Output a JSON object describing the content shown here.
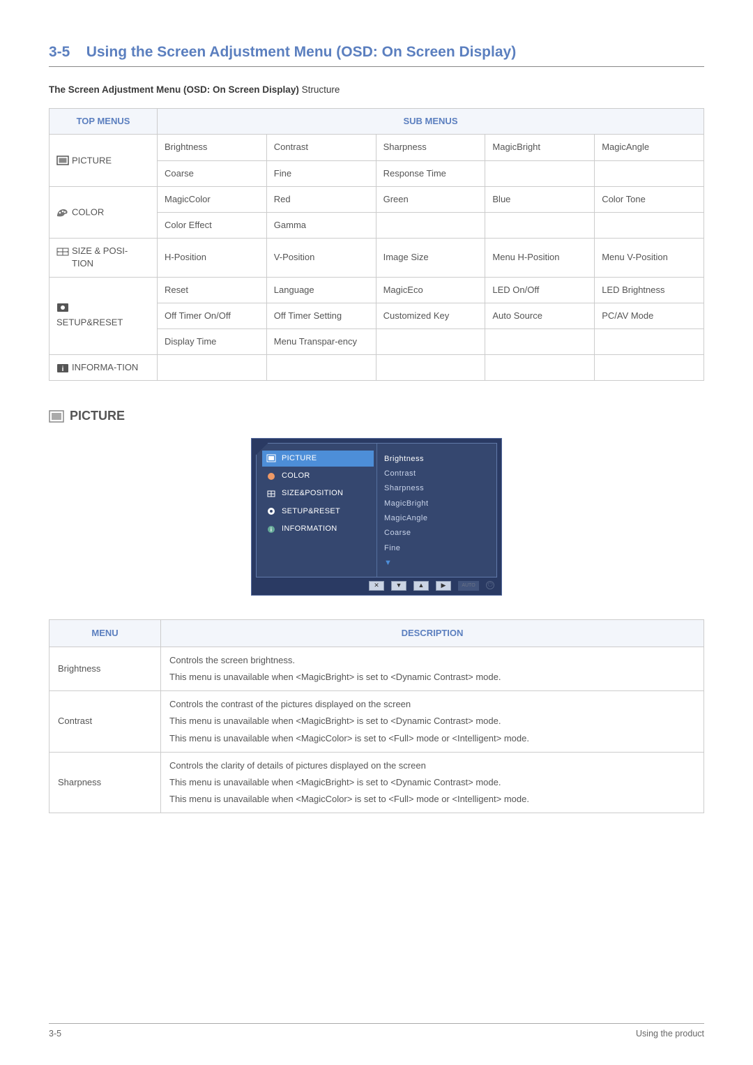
{
  "header": {
    "section_number": "3-5",
    "title": "Using the Screen Adjustment Menu (OSD: On Screen Display)",
    "intro_strong": "The Screen Adjustment Menu (OSD: On Screen Display)",
    "intro_rest": " Structure"
  },
  "struct_table": {
    "top_header": "TOP MENUS",
    "sub_header": "SUB MENUS",
    "rows": [
      {
        "top": "PICTURE",
        "icon": "picture-icon",
        "cells": [
          [
            "Brightness",
            "Contrast",
            "Sharpness",
            "MagicBright",
            "MagicAngle"
          ],
          [
            "Coarse",
            "Fine",
            "Response Time",
            "",
            ""
          ]
        ]
      },
      {
        "top": "COLOR",
        "icon": "color-icon",
        "cells": [
          [
            "MagicColor",
            "Red",
            "Green",
            "Blue",
            "Color Tone"
          ],
          [
            "Color Effect",
            "Gamma",
            "",
            "",
            ""
          ]
        ]
      },
      {
        "top": "SIZE & POSI-TION",
        "icon": "size-icon",
        "cells": [
          [
            "H-Position",
            "V-Position",
            "Image Size",
            "Menu H-Position",
            "Menu V-Position"
          ]
        ]
      },
      {
        "top": "SETUP&RESET",
        "icon": "setup-icon",
        "cells": [
          [
            "Reset",
            "Language",
            "MagicEco",
            "LED On/Off",
            "LED Brightness"
          ],
          [
            "Off Timer On/Off",
            "Off Timer Setting",
            "Customized Key",
            "Auto Source",
            "PC/AV Mode"
          ],
          [
            "Display Time",
            "Menu Transpar-ency",
            "",
            "",
            ""
          ]
        ]
      },
      {
        "top": "INFORMA-TION",
        "icon": "info-icon",
        "cells": [
          [
            "",
            "",
            "",
            "",
            ""
          ]
        ]
      }
    ]
  },
  "section_heading": "PICTURE",
  "osd": {
    "left": [
      {
        "label": "PICTURE",
        "selected": true
      },
      {
        "label": "COLOR",
        "selected": false
      },
      {
        "label": "SIZE&POSITION",
        "selected": false
      },
      {
        "label": "SETUP&RESET",
        "selected": false
      },
      {
        "label": "INFORMATION",
        "selected": false
      }
    ],
    "right": [
      "Brightness",
      "Contrast",
      "Sharpness",
      "MagicBright",
      "MagicAngle",
      "Coarse",
      "Fine"
    ],
    "bottom_buttons": [
      "✕",
      "▼",
      "▲",
      "▶",
      "AUTO",
      "⏻"
    ]
  },
  "desc_table": {
    "headers": {
      "menu": "MENU",
      "desc": "DESCRIPTION"
    },
    "rows": [
      {
        "menu": "Brightness",
        "lines": [
          "Controls the screen brightness.",
          "This menu is unavailable when <MagicBright> is set to <Dynamic Contrast> mode."
        ]
      },
      {
        "menu": "Contrast",
        "lines": [
          "Controls the contrast of the pictures displayed on the screen",
          "This menu is unavailable when <MagicBright> is set to <Dynamic Contrast> mode.",
          "This menu is unavailable when <MagicColor> is set to <Full> mode or <Intelligent> mode."
        ]
      },
      {
        "menu": "Sharpness",
        "lines": [
          "Controls the clarity of details of pictures displayed on the screen",
          "This menu is unavailable when <MagicBright> is set to <Dynamic Contrast> mode.",
          "This menu is unavailable when <MagicColor> is set to <Full> mode or <Intelligent> mode."
        ]
      }
    ]
  },
  "footer": {
    "left": "3-5",
    "right": "Using the product"
  }
}
